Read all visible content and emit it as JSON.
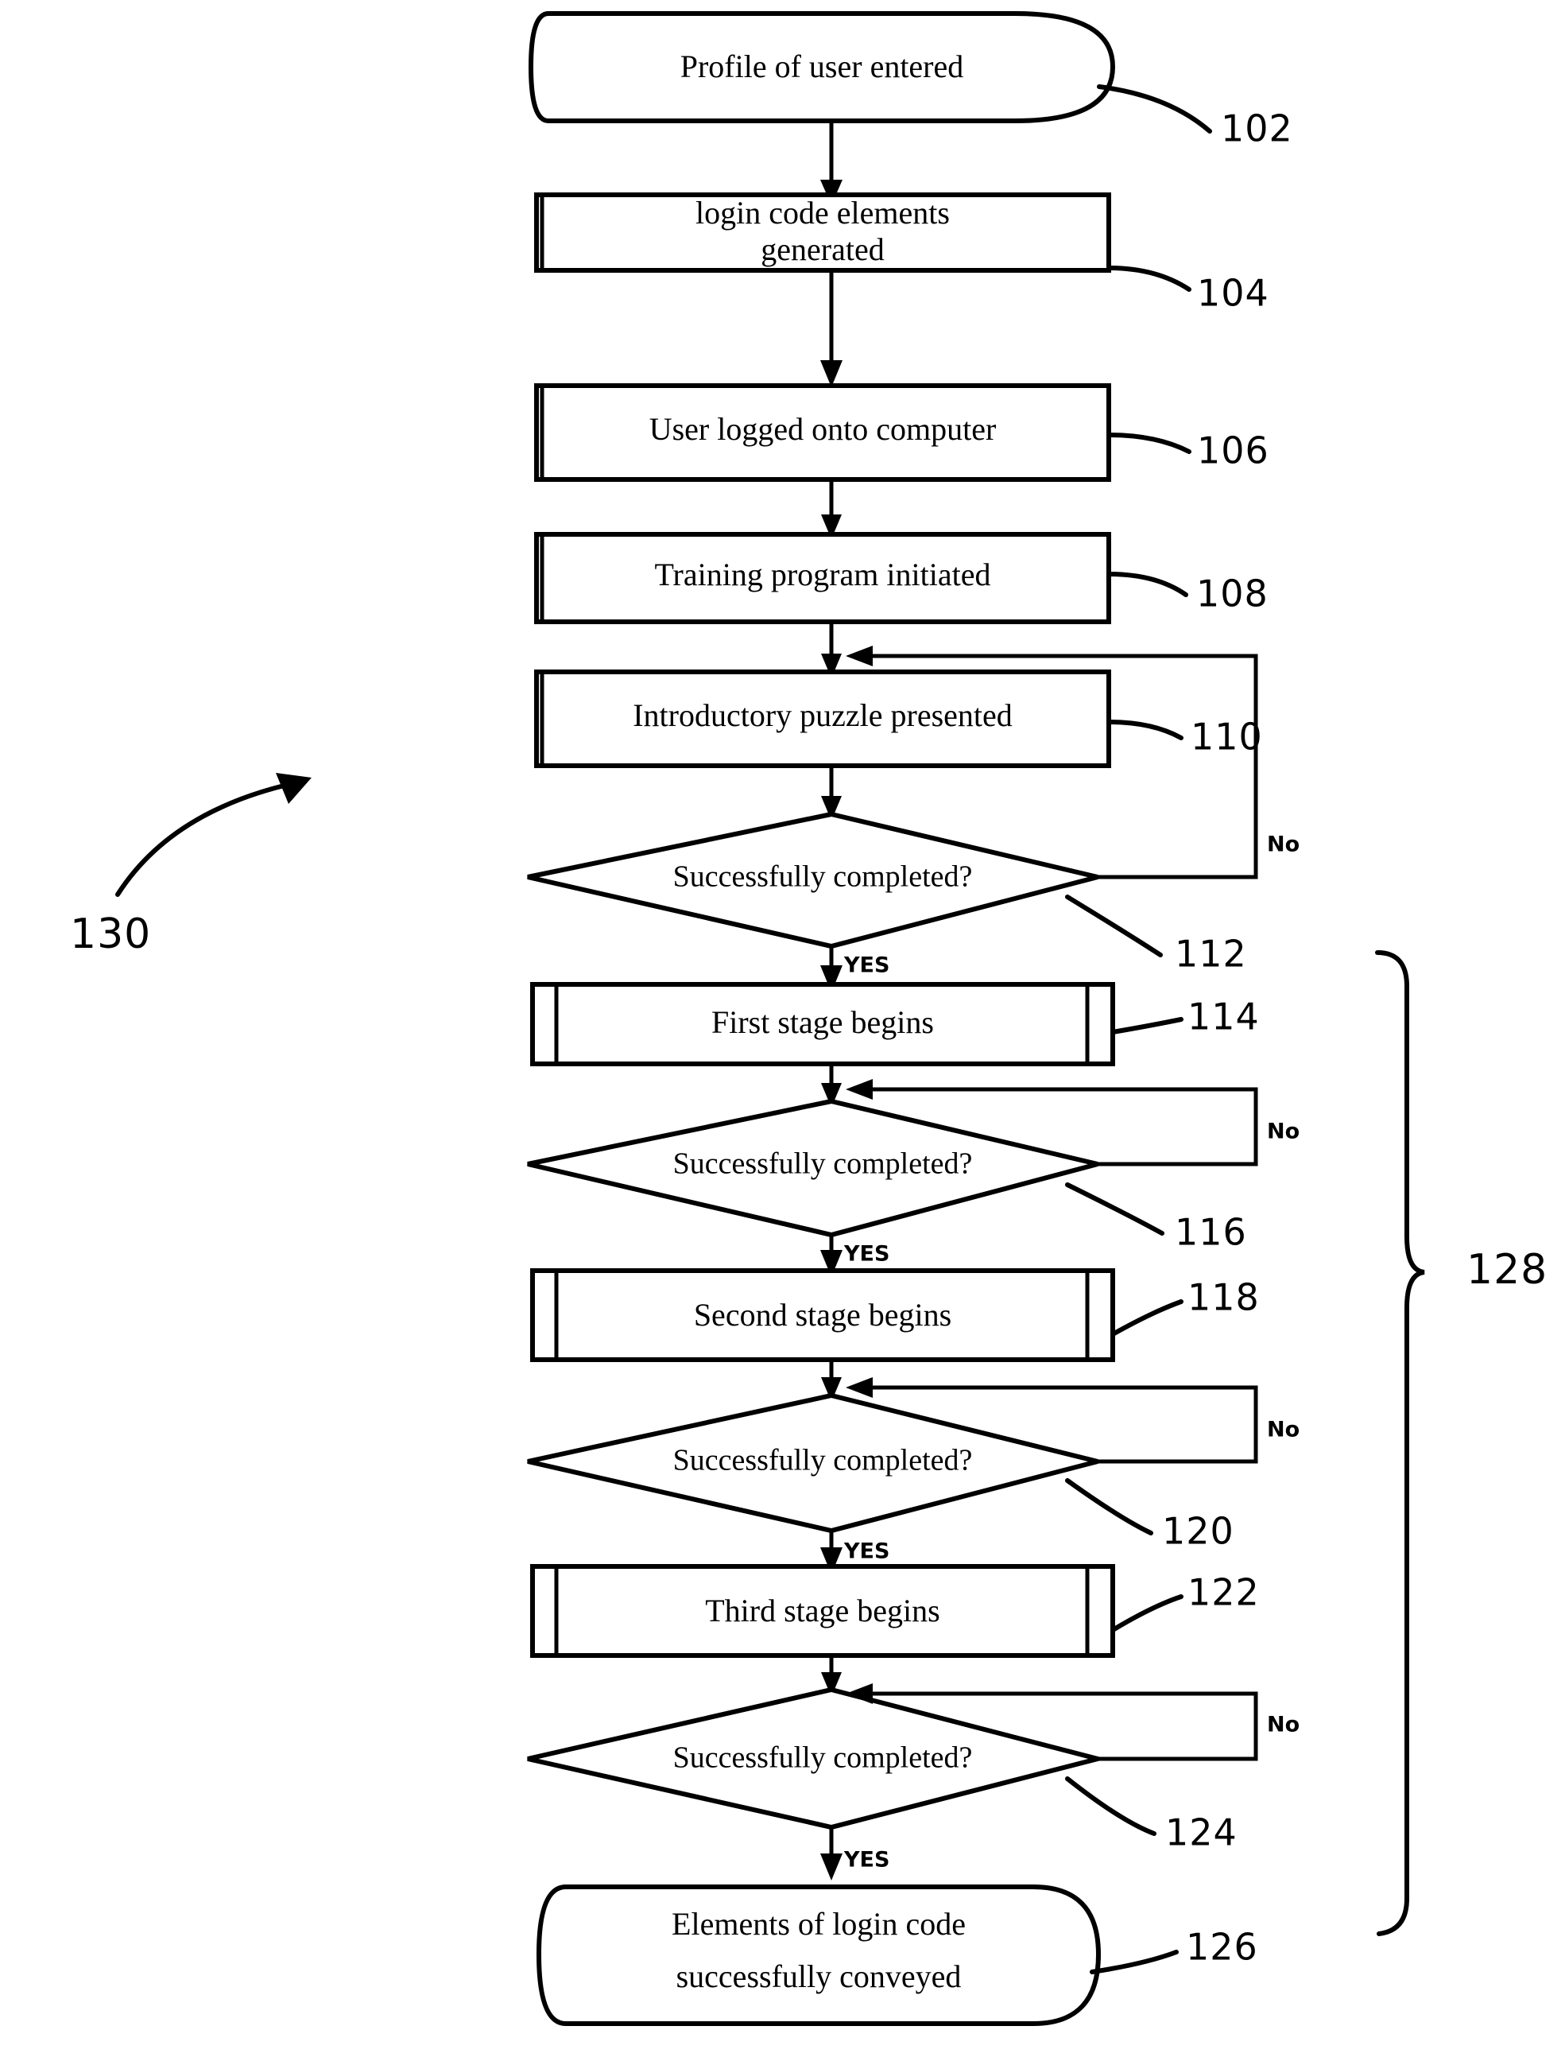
{
  "figure": {
    "type": "patent-flowchart",
    "overall_ref": "130",
    "bracket_ref": "128"
  },
  "nodes": [
    {
      "id": "n102",
      "shape": "terminator",
      "ref": "102",
      "lines": [
        "Profile of user entered"
      ]
    },
    {
      "id": "n104",
      "shape": "process",
      "ref": "104",
      "lines": [
        "login code elements",
        "generated"
      ]
    },
    {
      "id": "n106",
      "shape": "process",
      "ref": "106",
      "lines": [
        "User logged onto computer"
      ]
    },
    {
      "id": "n108",
      "shape": "process",
      "ref": "108",
      "lines": [
        "Training program initiated"
      ]
    },
    {
      "id": "n110",
      "shape": "process",
      "ref": "110",
      "lines": [
        "Introductory puzzle presented"
      ]
    },
    {
      "id": "n112",
      "shape": "decision",
      "ref": "112",
      "lines": [
        "Successfully completed?"
      ]
    },
    {
      "id": "n114",
      "shape": "subprocess",
      "ref": "114",
      "lines": [
        "First stage begins"
      ]
    },
    {
      "id": "n116",
      "shape": "decision",
      "ref": "116",
      "lines": [
        "Successfully completed?"
      ]
    },
    {
      "id": "n118",
      "shape": "subprocess",
      "ref": "118",
      "lines": [
        "Second stage begins"
      ]
    },
    {
      "id": "n120",
      "shape": "decision",
      "ref": "120",
      "lines": [
        "Successfully completed?"
      ]
    },
    {
      "id": "n122",
      "shape": "subprocess",
      "ref": "122",
      "lines": [
        "Third stage begins"
      ]
    },
    {
      "id": "n124",
      "shape": "decision",
      "ref": "124",
      "lines": [
        "Successfully completed?"
      ]
    },
    {
      "id": "n126",
      "shape": "terminator",
      "ref": "126",
      "lines": [
        "Elements of login code",
        "successfully conveyed"
      ]
    }
  ],
  "branch_labels": {
    "no_112": "No",
    "yes_112": "YES",
    "no_116": "No",
    "yes_116": "YES",
    "no_120": "No",
    "yes_120": "YES",
    "no_124": "No",
    "yes_124": "YES"
  },
  "colors": {
    "ink": "#000000",
    "paper": "#ffffff"
  }
}
